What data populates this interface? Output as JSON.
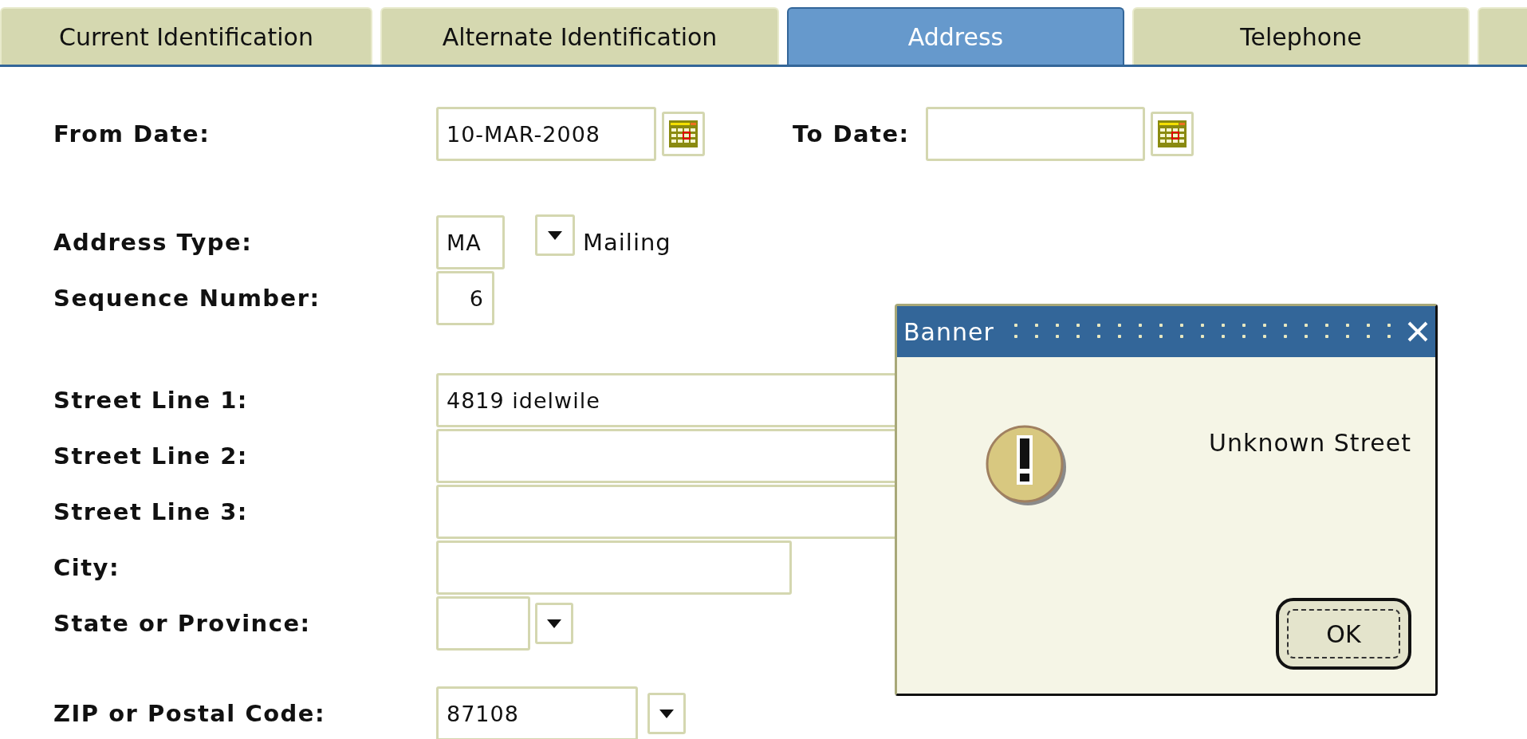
{
  "tabs": [
    {
      "label": "Current Identification",
      "selected": false
    },
    {
      "label": "Alternate Identification",
      "selected": false
    },
    {
      "label": "Address",
      "selected": true
    },
    {
      "label": "Telephone",
      "selected": false
    },
    {
      "selected": false
    }
  ],
  "dates": {
    "from": {
      "label": "From Date:",
      "value": "10-MAR-2008"
    },
    "to": {
      "label": "To Date:"
    }
  },
  "groups": [
    [
      {
        "kind": "lookup",
        "label": "Address Type:",
        "value": "MA",
        "description": "Mailing"
      },
      {
        "kind": "number",
        "label": "Sequence Number:",
        "value": "6"
      }
    ],
    [
      {
        "kind": "street",
        "label": "Street Line 1:",
        "value": "4819 idelwile"
      },
      {
        "kind": "street",
        "label": "Street Line 2:"
      },
      {
        "kind": "street",
        "label": "Street Line 3:"
      },
      {
        "kind": "city",
        "label": "City:"
      },
      {
        "kind": "state",
        "label": "State or Province:"
      }
    ],
    [
      {
        "kind": "postal",
        "label": "ZIP or Postal Code:",
        "value": "87108"
      }
    ]
  ],
  "dialog": {
    "title": "Banner",
    "message": "Unknown Street",
    "button": "OK"
  }
}
